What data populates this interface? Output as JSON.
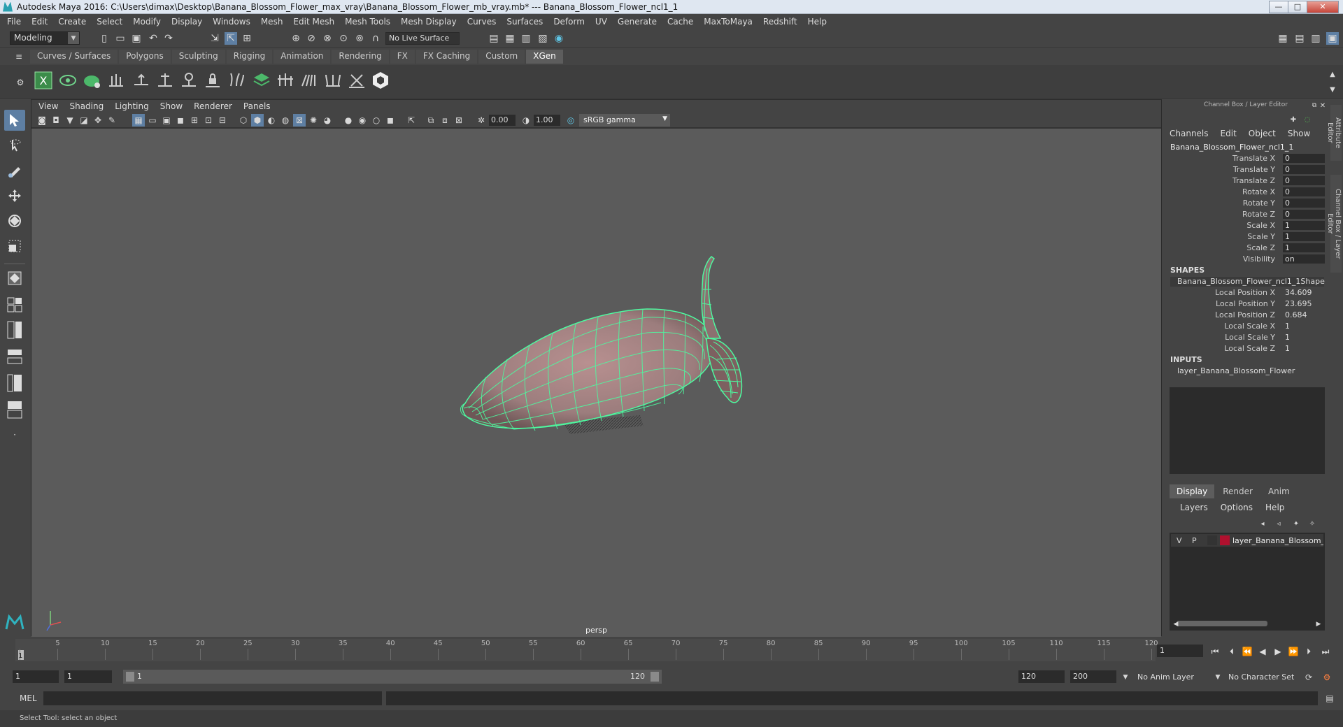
{
  "window": {
    "title": "Autodesk Maya 2016: C:\\Users\\dimax\\Desktop\\Banana_Blossom_Flower_max_vray\\Banana_Blossom_Flower_mb_vray.mb*   ---   Banana_Blossom_Flower_ncl1_1",
    "minimize": "—",
    "maximize": "□",
    "close": "✕"
  },
  "menubar": [
    "File",
    "Edit",
    "Create",
    "Select",
    "Modify",
    "Display",
    "Windows",
    "Mesh",
    "Edit Mesh",
    "Mesh Tools",
    "Mesh Display",
    "Curves",
    "Surfaces",
    "Deform",
    "UV",
    "Generate",
    "Cache",
    "MaxToMaya",
    "Redshift",
    "Help"
  ],
  "statusline": {
    "mode": "Modeling",
    "live_surface": "No Live Surface"
  },
  "shelf": {
    "tabs": [
      "Curves / Surfaces",
      "Polygons",
      "Sculpting",
      "Rigging",
      "Animation",
      "Rendering",
      "FX",
      "FX Caching",
      "Custom",
      "XGen"
    ],
    "active_tab": "XGen"
  },
  "viewport": {
    "menu": [
      "View",
      "Shading",
      "Lighting",
      "Show",
      "Renderer",
      "Panels"
    ],
    "exposure": "0.00",
    "gamma_value": "1.00",
    "color_space": "sRGB gamma",
    "camera": "persp"
  },
  "channel_box": {
    "header": "Channel Box / Layer Editor",
    "menu": [
      "Channels",
      "Edit",
      "Object",
      "Show"
    ],
    "object_name": "Banana_Blossom_Flower_ncl1_1",
    "transform": [
      {
        "label": "Translate X",
        "value": "0"
      },
      {
        "label": "Translate Y",
        "value": "0"
      },
      {
        "label": "Translate Z",
        "value": "0"
      },
      {
        "label": "Rotate X",
        "value": "0"
      },
      {
        "label": "Rotate Y",
        "value": "0"
      },
      {
        "label": "Rotate Z",
        "value": "0"
      },
      {
        "label": "Scale X",
        "value": "1"
      },
      {
        "label": "Scale Y",
        "value": "1"
      },
      {
        "label": "Scale Z",
        "value": "1"
      },
      {
        "label": "Visibility",
        "value": "on"
      }
    ],
    "shapes_label": "SHAPES",
    "shape_name": "Banana_Blossom_Flower_ncl1_1Shape",
    "shape_attrs": [
      {
        "label": "Local Position X",
        "value": "34.609"
      },
      {
        "label": "Local Position Y",
        "value": "23.695"
      },
      {
        "label": "Local Position Z",
        "value": "0.684"
      },
      {
        "label": "Local Scale X",
        "value": "1"
      },
      {
        "label": "Local Scale Y",
        "value": "1"
      },
      {
        "label": "Local Scale Z",
        "value": "1"
      }
    ],
    "inputs_label": "INPUTS",
    "input_name": "layer_Banana_Blossom_Flower"
  },
  "layer_editor": {
    "tabs": [
      "Display",
      "Render",
      "Anim"
    ],
    "active_tab": "Display",
    "menu": [
      "Layers",
      "Options",
      "Help"
    ],
    "layer": {
      "v": "V",
      "p": "P",
      "name": "layer_Banana_Blossom_F",
      "color": "#b0102e"
    }
  },
  "side_tabs": [
    "Attribute Editor",
    "Channel Box / Layer Editor"
  ],
  "timeline": {
    "ticks": [
      1,
      5,
      10,
      15,
      20,
      25,
      30,
      35,
      40,
      45,
      50,
      55,
      60,
      65,
      70,
      75,
      80,
      85,
      90,
      95,
      100,
      105,
      110,
      115,
      120
    ],
    "start": 1,
    "end": 120,
    "current_frame_label": "1",
    "current_frame_field": "1"
  },
  "range": {
    "start_field": "1",
    "playback_start": "1",
    "slider_start": "1",
    "slider_end": "120",
    "playback_end": "120",
    "end_field": "200",
    "anim_layer": "No Anim Layer",
    "character_set": "No Character Set"
  },
  "command_line": {
    "label": "MEL",
    "help": "Select Tool: select an object"
  },
  "colors": {
    "wireframe": "#4dfaa0",
    "mesh_fill": "#9c7d7d",
    "active_tool": "#5e7fa3",
    "viewport_bg": "#5b5b5b"
  }
}
